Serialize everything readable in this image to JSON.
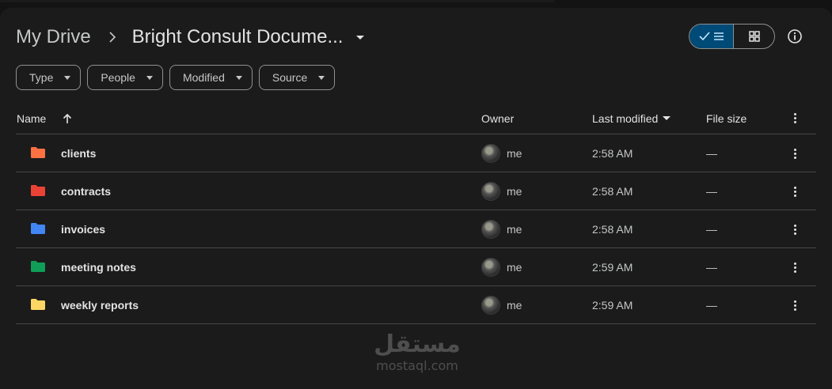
{
  "breadcrumb": {
    "root": "My Drive",
    "current": "Bright Consult Docume..."
  },
  "toolbar": {
    "list_view_selected": true,
    "icons": [
      "check-icon",
      "list-icon",
      "grid-icon",
      "info-icon"
    ]
  },
  "filters": [
    {
      "label": "Type"
    },
    {
      "label": "People"
    },
    {
      "label": "Modified"
    },
    {
      "label": "Source"
    }
  ],
  "table": {
    "columns": {
      "name": "Name",
      "owner": "Owner",
      "modified": "Last modified",
      "size": "File size"
    },
    "rows": [
      {
        "name": "clients",
        "owner": "me",
        "modified": "2:58 AM",
        "size": "—",
        "folder_color": "#ff7043"
      },
      {
        "name": "contracts",
        "owner": "me",
        "modified": "2:58 AM",
        "size": "—",
        "folder_color": "#ea4335"
      },
      {
        "name": "invoices",
        "owner": "me",
        "modified": "2:58 AM",
        "size": "—",
        "folder_color": "#4285f4"
      },
      {
        "name": "meeting notes",
        "owner": "me",
        "modified": "2:59 AM",
        "size": "—",
        "folder_color": "#0f9d58"
      },
      {
        "name": "weekly reports",
        "owner": "me",
        "modified": "2:59 AM",
        "size": "—",
        "folder_color": "#fdd663"
      }
    ]
  },
  "watermark": {
    "arabic": "مستقل",
    "latin": "mostaql.com"
  },
  "colors": {
    "background": "#131314",
    "panel": "#1b1b1b",
    "accent": "#004a77",
    "divider": "#444746"
  }
}
